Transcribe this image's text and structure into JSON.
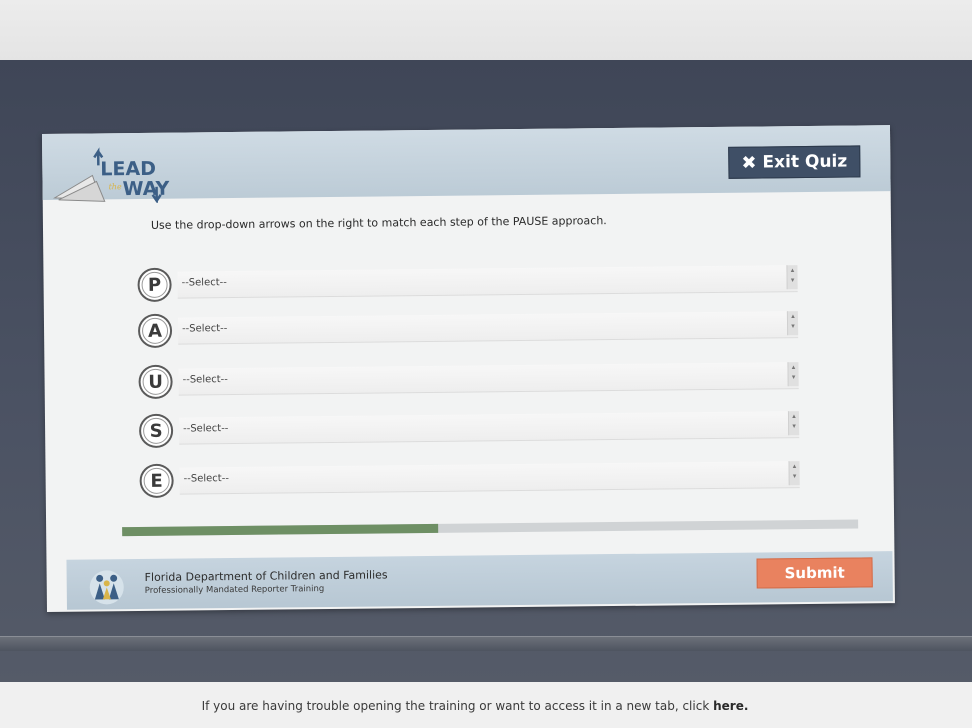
{
  "header": {
    "logo_lead": "LEAD",
    "logo_the": "the",
    "logo_way": "WAY",
    "exit_label": "Exit Quiz",
    "exit_icon": "close-icon"
  },
  "instructions": "Use the drop-down arrows on the right to match each step of the PAUSE approach.",
  "steps": [
    {
      "letter": "P",
      "selected": "--Select--"
    },
    {
      "letter": "A",
      "selected": "--Select--"
    },
    {
      "letter": "U",
      "selected": "--Select--"
    },
    {
      "letter": "S",
      "selected": "--Select--"
    },
    {
      "letter": "E",
      "selected": "--Select--"
    }
  ],
  "progress": {
    "fraction": 0.43,
    "color": "#6e8f64"
  },
  "footer": {
    "org_name": "Florida Department of Children and Families",
    "org_subtitle": "Professionally Mandated Reporter Training",
    "submit_label": "Submit"
  },
  "page_footer": {
    "text": "If you are having trouble opening the training or want to access it in a new tab, click",
    "link": "here."
  },
  "colors": {
    "exit_button": "#3f4f66",
    "submit_button": "#e9825f",
    "header_bg": "#c6d4df"
  }
}
